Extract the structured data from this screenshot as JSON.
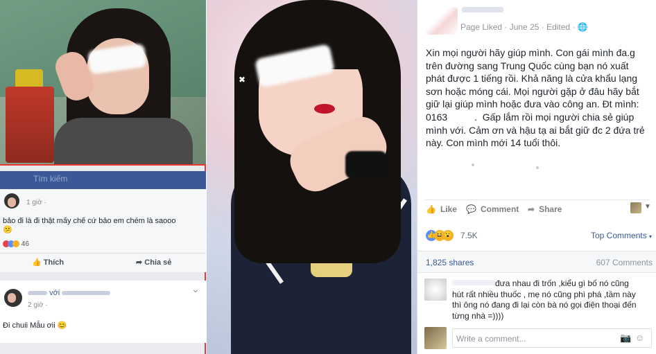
{
  "left_fb": {
    "search_placeholder": "Tìm kiếm",
    "comment1_time": "1 giờ ·",
    "comment1_text": "bảo đi là đi thật mấy chế cứ bảo em chém là saooo",
    "comment1_emoji": "😕",
    "comment1_reactions": "46",
    "like_label": "Thích",
    "share_label": "Chia sẻ",
    "comment2_author": "với",
    "comment2_time": "2 giờ ·",
    "comment2_text": "Đi chuii Mẫu ơii 😊",
    "comment2_chevron": "⌄"
  },
  "post": {
    "meta": "Page Liked · June 25 · Edited · 🌐",
    "body": "Xin mọi người hãy giúp mình. Con gái mình đa.g\ntrên đường sang Trung Quốc cùng bạn nó xuất\nphát được 1 tiếng rồi. Khả năng là cửa khẩu lạng\nsơn hoặc móng cái. Mọi người gặp ở đâu hãy bắt\ngiữ lại giúp mình hoặc đưa vào công an. Đt mình:\n0163          .  Gấp lắm rồi mọi người chia sẻ giúp\nmình với. Cảm ơn và hậu tạ ai bắt giữ đc 2 đứa trẻ\nnày. Con mình mới 14 tuổi thôi.",
    "like_label": "Like",
    "comment_label": "Comment",
    "share_label": "Share",
    "reaction_count": "7.5K",
    "top_comments": "Top Comments",
    "shares": "1,825 shares",
    "comments_count": "607 Comments",
    "comment_text": "đưa nhau đi trốn ,kiểu gì bố nó cũng\nhút rất nhiều thuốc , mẹ nó cũng phì phá ,tầm này\nthì ông nó đang đi lại còn bà nó gọi điện thoại đến\ntừng nhà =))))",
    "write_placeholder": "Write a comment..."
  },
  "colors": {
    "fb_blue": "#3b5998",
    "link": "#365899",
    "muted": "#90949c",
    "red_frame": "#ee3333"
  }
}
